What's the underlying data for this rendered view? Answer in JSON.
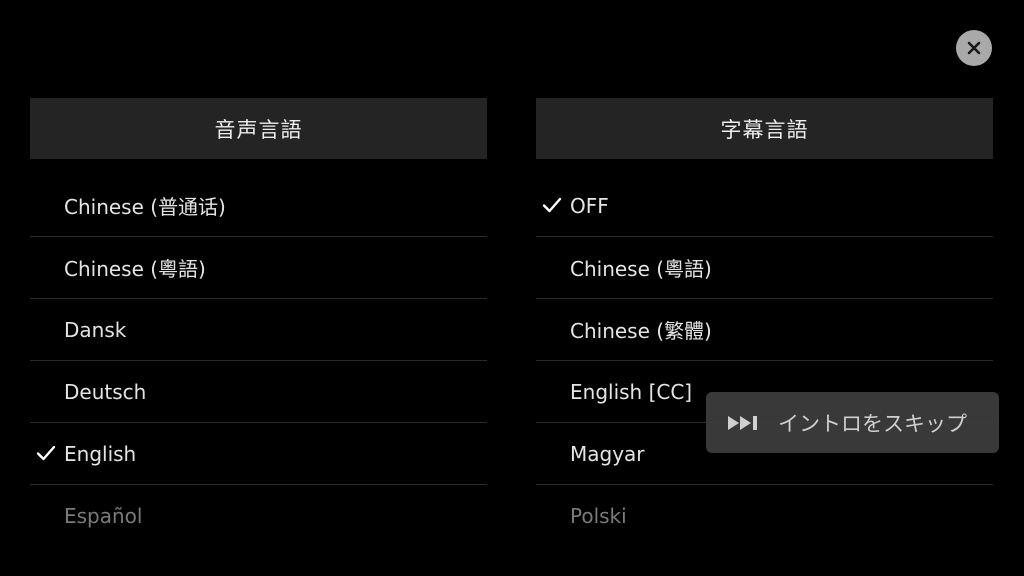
{
  "close": {
    "icon": "close-icon"
  },
  "audio": {
    "title": "音声言語",
    "items": [
      {
        "label": "Chinese (普通话)",
        "selected": false
      },
      {
        "label": "Chinese (粵語)",
        "selected": false
      },
      {
        "label": "Dansk",
        "selected": false
      },
      {
        "label": "Deutsch",
        "selected": false
      },
      {
        "label": "English",
        "selected": true
      },
      {
        "label": "Español",
        "selected": false
      }
    ]
  },
  "subtitles": {
    "title": "字幕言語",
    "items": [
      {
        "label": "OFF",
        "selected": true
      },
      {
        "label": "Chinese (粵語)",
        "selected": false
      },
      {
        "label": "Chinese (繁體)",
        "selected": false
      },
      {
        "label": "English [CC]",
        "selected": false
      },
      {
        "label": "Magyar",
        "selected": false
      },
      {
        "label": "Polski",
        "selected": false
      }
    ]
  },
  "skip_intro": {
    "label": "イントロをスキップ",
    "icon": "skip-forward-icon"
  },
  "colors": {
    "background": "#000000",
    "header_bg": "#242424",
    "divider": "#2a2a2a",
    "close_bg": "#a9a9a9",
    "skip_bg": "#3e3e3e"
  }
}
